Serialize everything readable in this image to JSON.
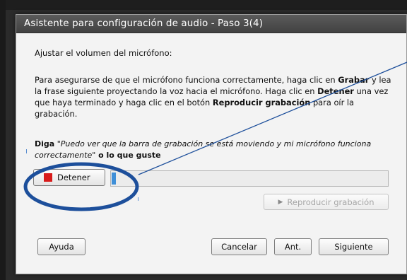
{
  "dialog": {
    "title": "Asistente para configuración de audio - Paso 3(4)",
    "heading": "Ajustar el volumen del micrófono:",
    "instructions": {
      "t1": "Para asegurarse de que el micrófono funciona correctamente, haga clic en ",
      "b1": "Grabar",
      "t2": " y lea la frase siguiente proyectando la voz hacia el micrófono. Haga clic en ",
      "b2": "Detener",
      "t3": " una vez que haya terminado y haga clic en el botón ",
      "b3": "Reproducir grabación",
      "t4": " para oír la grabación."
    },
    "say_label": "Diga",
    "say_phrase": "\"Puedo ver que la barra de grabación se está moviendo y mi micrófono funciona correctamente\"",
    "say_suffix": " o lo que guste",
    "stop_label": "Detener",
    "stop_color": "#d81b1b",
    "level_fraction": 0.015,
    "level_color": "#3f8fd8",
    "play_label": "Reproducir grabación",
    "play_enabled": false,
    "buttons": {
      "help": "Ayuda",
      "cancel": "Cancelar",
      "prev": "Ant.",
      "next": "Siguiente"
    }
  },
  "annotation": {
    "color": "#1d4f9b",
    "shape": "ellipse-with-pointer-line"
  }
}
